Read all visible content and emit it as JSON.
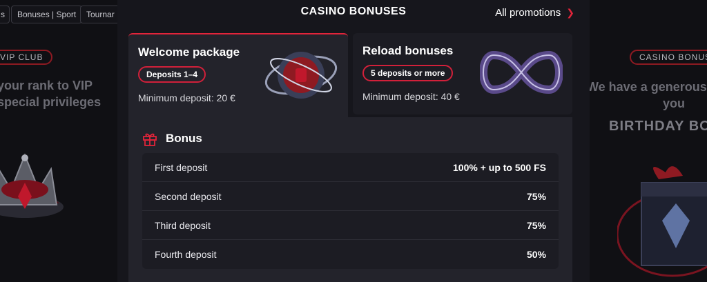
{
  "top_chips": [
    "s",
    "Bonuses | Sport",
    "Tournar"
  ],
  "left_panel": {
    "badge": "VIP CLUB",
    "line1": "your rank to VIP",
    "line2": "special privileges"
  },
  "right_panel": {
    "badge": "CASINO BONUS",
    "line1": "We have a generous g",
    "line2": "you",
    "line3": "BIRTHDAY BO"
  },
  "header": {
    "title": "CASINO BONUSES",
    "all_promotions": "All promotions"
  },
  "tabs": [
    {
      "title": "Welcome package",
      "badge": "Deposits 1–4",
      "min_deposit": "Minimum deposit: 20 €",
      "active": true
    },
    {
      "title": "Reload bonuses",
      "badge": "5 deposits or more",
      "min_deposit": "Minimum deposit: 40 €",
      "active": false
    }
  ],
  "bonus": {
    "heading": "Bonus",
    "rows": [
      {
        "label": "First deposit",
        "value": "100% + up to 500 FS"
      },
      {
        "label": "Second deposit",
        "value": "75%"
      },
      {
        "label": "Third deposit",
        "value": "75%"
      },
      {
        "label": "Fourth deposit",
        "value": "50%"
      }
    ]
  },
  "colors": {
    "accent": "#e2243a",
    "panel": "#16161c",
    "card": "#23232b"
  },
  "icons": {
    "gift": "gift-icon",
    "chevron": "chevron-right-icon"
  }
}
